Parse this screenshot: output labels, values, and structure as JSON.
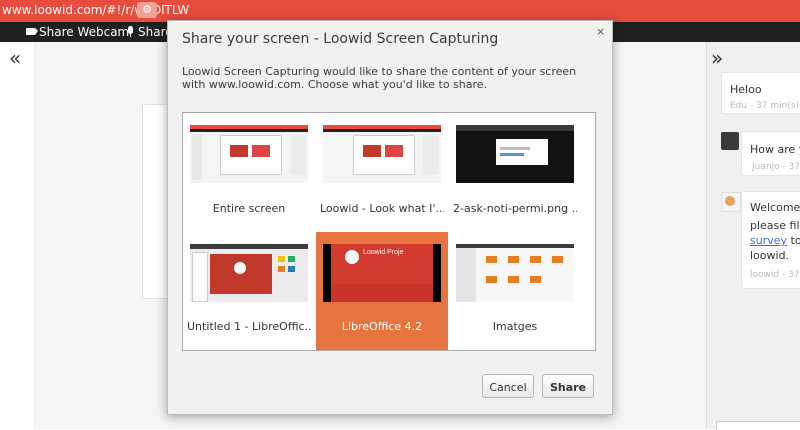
{
  "browser": {
    "url": "www.loowid.com/#!/r/wqOlTLW",
    "settings_icon": "gear-icon"
  },
  "toolbar": {
    "share_webcam_label": "Share Webcam",
    "share_label": "Share",
    "webcam_icon": "camera-icon",
    "mic_icon": "microphone-icon"
  },
  "panels": {
    "left_collapse": "«",
    "right_collapse": "»"
  },
  "chat": {
    "messages": [
      {
        "lines": [
          "Heloo"
        ],
        "author_time": "Edu - 37 min(s) ago"
      },
      {
        "lines": [
          "How are you"
        ],
        "author_time": "Juanjo - 37 min"
      },
      {
        "lines": [
          "Welcome to",
          "please fill ou"
        ],
        "link_text": "survey",
        "link_suffix": " to hel",
        "last_line": "loowid.",
        "author_time": "loowid - 37 min(s)"
      }
    ]
  },
  "dialog": {
    "title": "Share your screen - Loowid Screen Capturing",
    "close_icon": "×",
    "description": "Loowid Screen Capturing would like to share the content of your screen with www.loowid.com. Choose what you'd like to share.",
    "sources": [
      {
        "label": "Entire screen",
        "selected": false
      },
      {
        "label": "Loowid - Look what I'...",
        "selected": false
      },
      {
        "label": "2-ask-noti-permi.png ...",
        "selected": false
      },
      {
        "label": "Untitled 1 - LibreOffic...",
        "selected": false
      },
      {
        "label": "LibreOffice 4.2",
        "selected": true,
        "slide_title": "Loowid Proje"
      },
      {
        "label": "Imatges",
        "selected": false
      }
    ],
    "cancel_label": "Cancel",
    "share_label": "Share"
  },
  "colors": {
    "brand": "#e84c3d",
    "selected": "#e5743f",
    "toolbar": "#202020"
  }
}
